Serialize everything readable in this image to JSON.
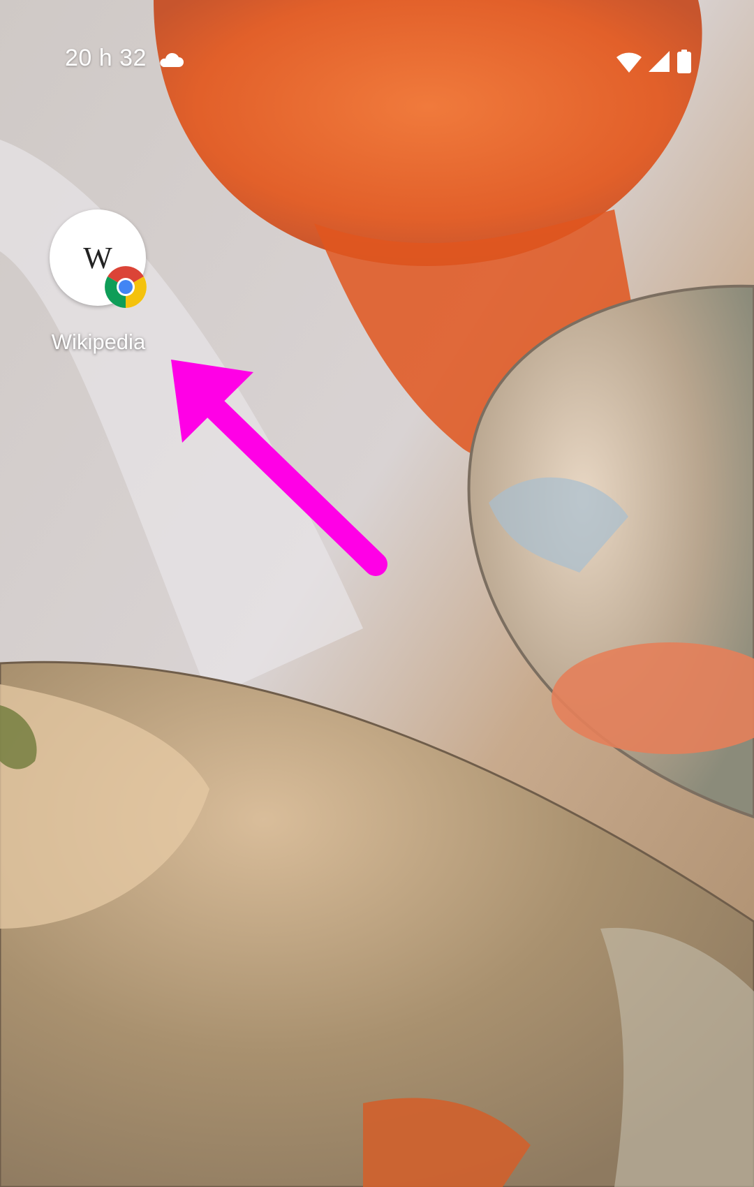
{
  "status_bar": {
    "time": "20 h 32",
    "weather_icon": "cloud-icon",
    "wifi_icon": "wifi-icon",
    "signal_icon": "cellular-signal-icon",
    "battery_icon": "battery-icon"
  },
  "home": {
    "shortcut": {
      "label": "Wikipedia",
      "logo_text": "W",
      "badge_icon": "chrome-icon"
    }
  },
  "annotation": {
    "arrow_color": "#ff00e6"
  }
}
